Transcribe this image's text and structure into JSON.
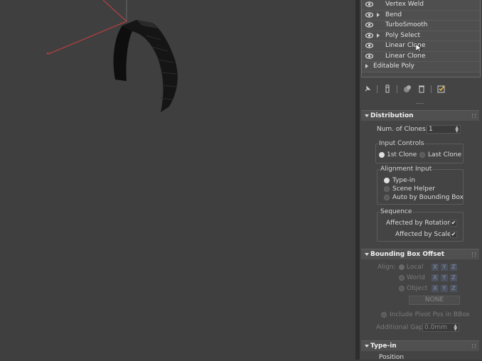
{
  "modifier_stack": {
    "items": [
      {
        "label": "Vertex Weld",
        "has_arrow": false
      },
      {
        "label": "Bend",
        "has_arrow": true
      },
      {
        "label": "TurboSmooth",
        "has_arrow": false
      },
      {
        "label": "Poly Select",
        "has_arrow": true
      },
      {
        "label": "Linear Clone",
        "has_arrow": false
      },
      {
        "label": "Linear Clone",
        "has_arrow": false
      }
    ],
    "base": "Editable Poly"
  },
  "toolbar": {
    "icons": [
      "pin-stack-icon",
      "show-end-result-icon",
      "make-unique-icon",
      "remove-modifier-icon",
      "configure-modifier-sets-icon"
    ]
  },
  "distribution": {
    "title": "Distribution",
    "num_clones_label": "Num. of Clones:",
    "num_clones_value": "1",
    "input_controls": {
      "title": "Input Controls",
      "options": [
        "1st Clone",
        "Last Clone"
      ],
      "selected": "1st Clone"
    },
    "alignment_input": {
      "title": "Alignment Input",
      "options": [
        "Type-in",
        "Scene Helper",
        "Auto by Bounding Box"
      ],
      "selected": "Type-in"
    },
    "sequence": {
      "title": "Sequence",
      "affected_by_rotation_label": "Affected by Rotation:",
      "affected_by_rotation": true,
      "affected_by_scale_label": "Affected by Scale:",
      "affected_by_scale": true
    }
  },
  "bounding_box_offset": {
    "title": "Bounding Box Offset",
    "align_label": "Align:",
    "options": [
      "Local",
      "World",
      "Object"
    ],
    "selected": "Local",
    "axes": [
      "X",
      "Y",
      "Z"
    ],
    "none_label": "NONE",
    "include_pivot_label": "Include Pivot Pos in BBox",
    "additional_gap_label": "Additional Gap:",
    "additional_gap_value": "0.0mm"
  },
  "type_in": {
    "title": "Type-in",
    "position_label": "Position"
  },
  "colors": {
    "viewport_bg": "#3f3f3f",
    "panel_bg": "#444444",
    "axis_red": "#c84040"
  }
}
